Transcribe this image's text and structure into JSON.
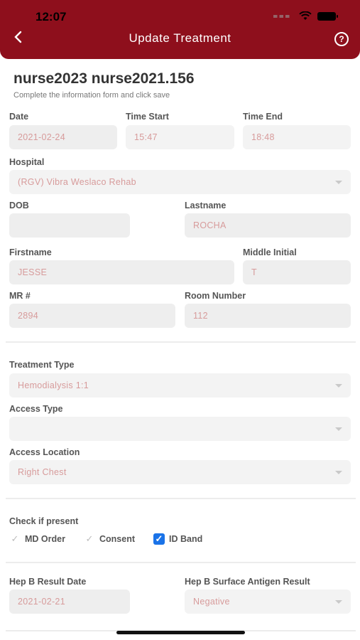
{
  "status": {
    "time": "12:07"
  },
  "nav": {
    "back_icon": "chevron-left-icon",
    "title": "Update Treatment",
    "help_icon": "help-circle-icon",
    "bg": "#8e0f1c"
  },
  "page": {
    "title": "nurse2023 nurse2021.156",
    "subtitle": "Complete the information form and click save"
  },
  "form": {
    "date": {
      "label": "Date",
      "value": "2021-02-24"
    },
    "time_start": {
      "label": "Time Start",
      "value": "15:47"
    },
    "time_end": {
      "label": "Time End",
      "value": "18:48"
    },
    "hospital": {
      "label": "Hospital",
      "value": "(RGV) Vibra Weslaco Rehab"
    },
    "dob": {
      "label": "DOB",
      "value": ""
    },
    "lastname": {
      "label": "Lastname",
      "value": "ROCHA"
    },
    "firstname": {
      "label": "Firstname",
      "value": "JESSE"
    },
    "middle_initial": {
      "label": "Middle Initial",
      "value": "T"
    },
    "mr": {
      "label": "MR #",
      "value": "2894"
    },
    "room_number": {
      "label": "Room Number",
      "value": "112"
    },
    "treatment_type": {
      "label": "Treatment Type",
      "value": "Hemodialysis 1:1"
    },
    "access_type": {
      "label": "Access Type",
      "value": ""
    },
    "access_location": {
      "label": "Access Location",
      "value": "Right Chest"
    },
    "check_if_present": {
      "label": "Check if present",
      "items": [
        {
          "label": "MD Order",
          "checked": true
        },
        {
          "label": "Consent",
          "checked": true
        },
        {
          "label": "ID Band",
          "checked": true
        }
      ]
    },
    "hep_b_result_date": {
      "label": "Hep B Result Date",
      "value": "2021-02-21"
    },
    "hep_b_surface_antigen": {
      "label": "Hep B Surface Antigen Result",
      "value": "Negative"
    }
  }
}
